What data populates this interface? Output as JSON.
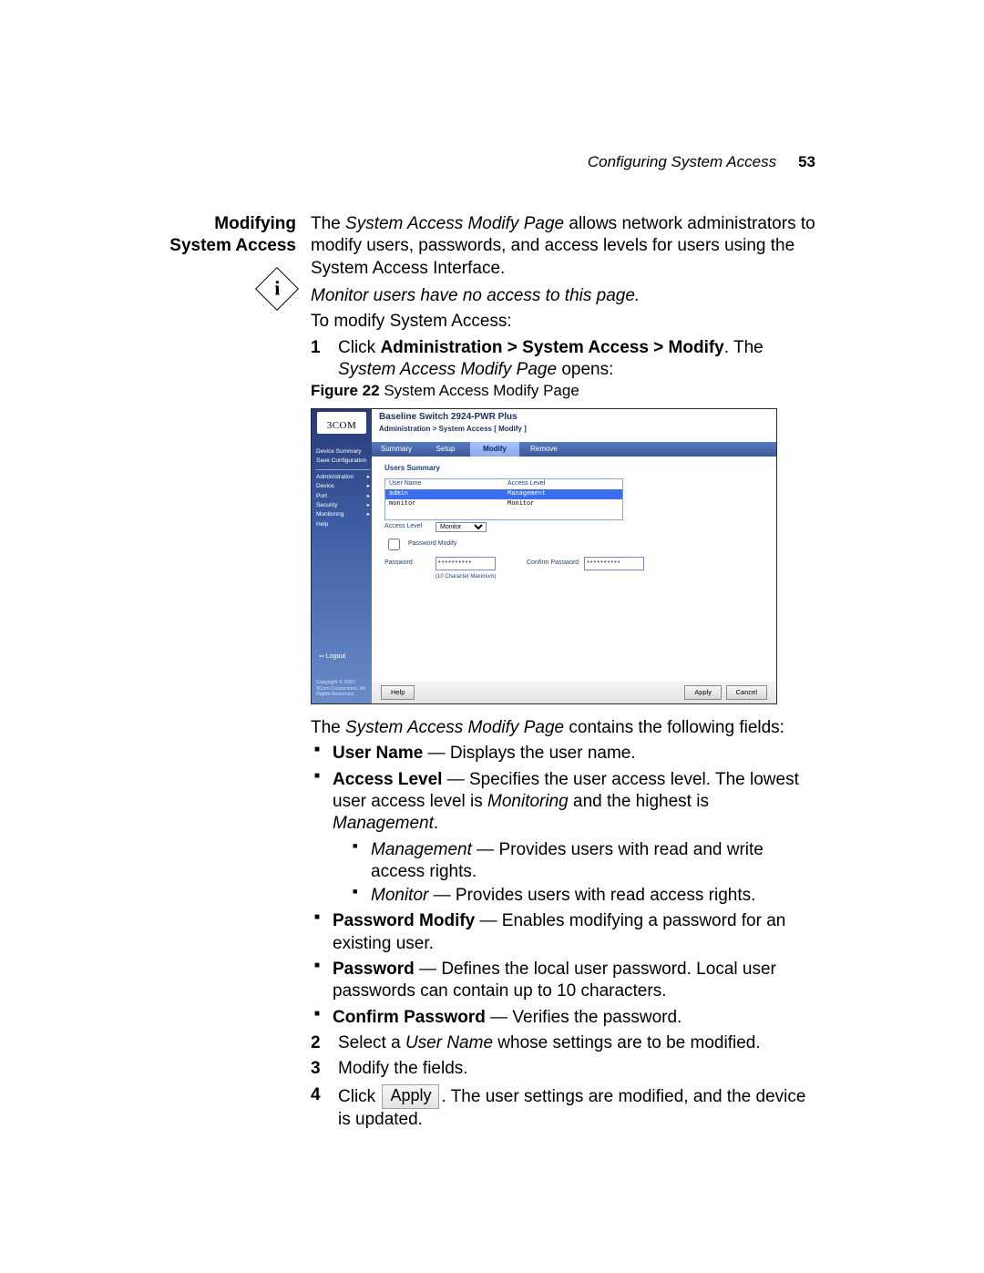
{
  "page": {
    "running_header": "Configuring System Access",
    "page_number": "53",
    "section_title": "Modifying System Access"
  },
  "intro": {
    "p1_a": "The ",
    "p1_b": "System Access Modify Page",
    "p1_c": " allows network administrators to modify users, passwords, and access levels for users using the System Access Interface.",
    "note": "Monitor users have no access to this page.",
    "p2": "To modify System Access:"
  },
  "steps": {
    "s1_num": "1",
    "s1_a": "Click ",
    "s1_b": "Administration > System Access > Modify",
    "s1_c": ". The ",
    "s1_d": "System Access Modify Page",
    "s1_e": " opens:",
    "s2_num": "2",
    "s2_a": "Select a ",
    "s2_b": "User Name",
    "s2_c": " whose settings are to be modified.",
    "s3_num": "3",
    "s3": "Modify the fields.",
    "s4_num": "4",
    "s4_a": "Click ",
    "s4_btn": "Apply",
    "s4_b": ". The user settings are modified, and the device is updated."
  },
  "figure": {
    "caption_a": "Figure 22",
    "caption_b": "   System Access Modify Page",
    "device_title": "Baseline Switch 2924-PWR Plus",
    "breadcrumb": "Administration > System Access [ Modify ]",
    "logo": "3COM",
    "tabs": {
      "t1": "Summary",
      "t2": "Setup",
      "t3": "Modify",
      "t4": "Remove"
    },
    "side": {
      "i1": "Device Summary",
      "i2": "Save Configuration",
      "i3": "Administration",
      "i4": "Device",
      "i5": "Port",
      "i6": "Security",
      "i7": "Monitoring",
      "i8": "Help",
      "logout": "⇦ Logout",
      "copyright": "Copyright © 2007\n3Com Corporation.\nAll Rights Reserved."
    },
    "panel": {
      "title": "Users Summary",
      "col1": "User Name",
      "col2": "Access Level",
      "r1c1": "admin",
      "r1c2": "Management",
      "r2c1": "monitor",
      "r2c2": "Monitor",
      "access_label": "Access Level",
      "access_val": "Monitor",
      "pw_modify": "Password Modify",
      "pw_label": "Password",
      "pw_val": "**********",
      "pw_hint": "(10 Character Maximum)",
      "cpw_label": "Confirm Password",
      "cpw_val": "**********"
    },
    "buttons": {
      "help": "Help",
      "apply": "Apply",
      "cancel": "Cancel"
    }
  },
  "after": {
    "lead_a": "The ",
    "lead_b": "System Access Modify Page",
    "lead_c": " contains the following fields:",
    "b1_a": "User Name",
    "b1_b": " — Displays the user name.",
    "b2_a": "Access Level",
    "b2_b": " — Specifies the user access level. The lowest user access level is ",
    "b2_c": "Monitoring",
    "b2_d": " and the highest is ",
    "b2_e": "Management",
    "b2_f": ".",
    "b2s1_a": "Management",
    "b2s1_b": " — Provides users with read and write access rights.",
    "b2s2_a": "Monitor",
    "b2s2_b": " — Provides users with read access rights.",
    "b3_a": "Password Modify",
    "b3_b": " — Enables modifying a password for an existing user.",
    "b4_a": "Password",
    "b4_b": " — Defines the local user password. Local user passwords can contain up to 10 characters.",
    "b5_a": "Confirm Password",
    "b5_b": " — Verifies the password."
  }
}
